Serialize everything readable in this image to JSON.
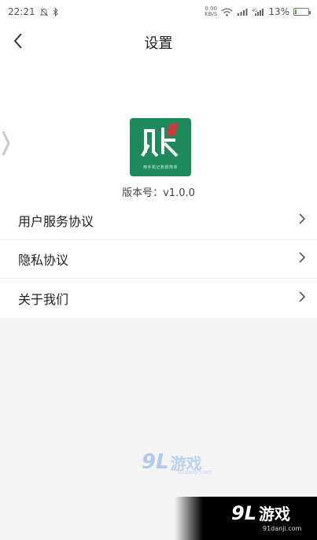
{
  "status_bar": {
    "time": "22:21",
    "net_speed_value": "0.00",
    "net_speed_unit": "KB/S",
    "battery": "13%",
    "battery_level": 0.13,
    "icons": [
      "mute-icon",
      "bluetooth-icon",
      "wifi-icon",
      "signal-icon",
      "4g-signal-icon",
      "battery-icon"
    ]
  },
  "header": {
    "title": "设置",
    "back_icon": "chevron-left-icon"
  },
  "about": {
    "logo_char": "账",
    "logo_tagline": "用手机记账很简单",
    "version_label": "版本号：v1.0.0"
  },
  "menu": {
    "items": [
      {
        "label": "用户服务协议",
        "icon": "chevron-right-icon"
      },
      {
        "label": "隐私协议",
        "icon": "chevron-right-icon"
      },
      {
        "label": "关于我们",
        "icon": "chevron-right-icon"
      }
    ]
  },
  "watermark": {
    "number": "9L",
    "text": "游戏",
    "url": "91danji.com"
  },
  "colors": {
    "logo_bg": "#1d8a5c",
    "logo_accent": "#d03a3a",
    "page_bg": "#f4f4f4",
    "battery_fill": "#49b32f"
  }
}
